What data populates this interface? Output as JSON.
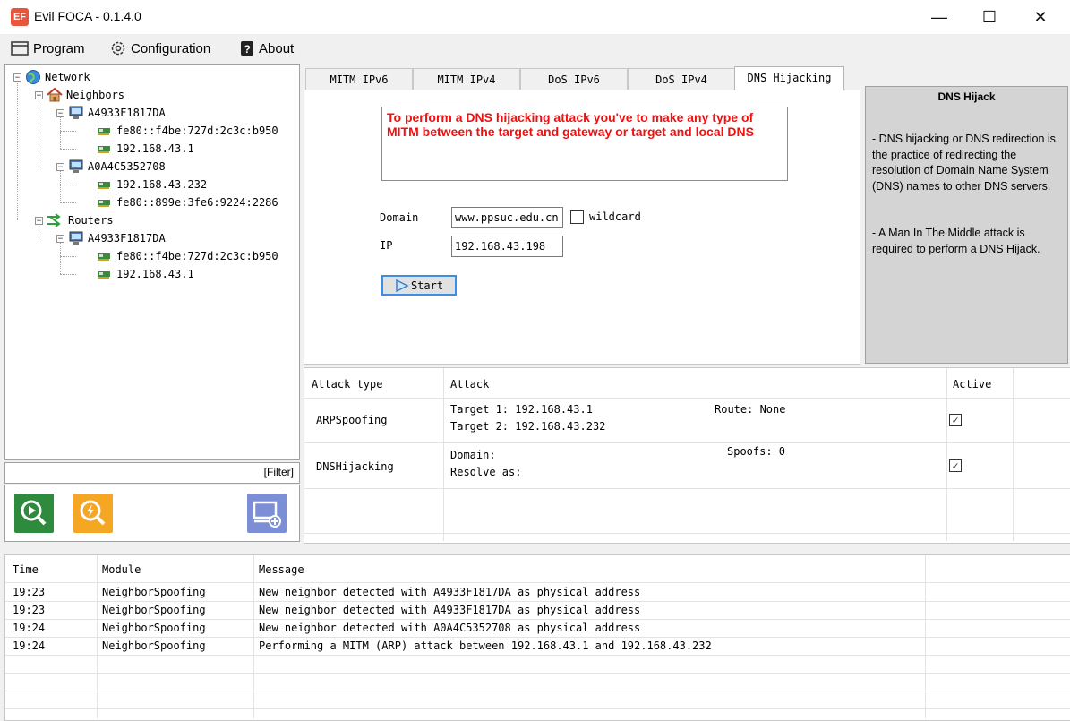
{
  "window": {
    "title": "Evil FOCA - 0.1.4.0",
    "icon_text": "EF",
    "minimize": "—",
    "maximize": "☐",
    "close": "✕"
  },
  "menu": {
    "items": [
      {
        "label": "Program",
        "icon": "window-icon"
      },
      {
        "label": "Configuration",
        "icon": "gear-icon"
      },
      {
        "label": "About",
        "icon": "help-icon"
      }
    ]
  },
  "tree": {
    "root": "Network",
    "neighbors": {
      "label": "Neighbors",
      "hosts": [
        {
          "name": "A4933F1817DA",
          "addresses": [
            "fe80::f4be:727d:2c3c:b950",
            "192.168.43.1"
          ]
        },
        {
          "name": "A0A4C5352708",
          "addresses": [
            "192.168.43.232",
            "fe80::899e:3fe6:9224:2286"
          ]
        }
      ]
    },
    "routers": {
      "label": "Routers",
      "hosts": [
        {
          "name": "A4933F1817DA",
          "addresses": [
            "fe80::f4be:727d:2c3c:b950",
            "192.168.43.1"
          ]
        }
      ]
    },
    "filter_label": "[Filter]"
  },
  "tabs": [
    {
      "label": "MITM IPv6",
      "active": false
    },
    {
      "label": "MITM IPv4",
      "active": false
    },
    {
      "label": "DoS IPv6",
      "active": false
    },
    {
      "label": "DoS IPv4",
      "active": false
    },
    {
      "label": "DNS Hijacking",
      "active": true
    }
  ],
  "dns_form": {
    "warning": "To perform a DNS hijacking attack you've to make any type of MITM between the target and gateway or target and local DNS",
    "domain_label": "Domain",
    "domain_value": "www.ppsuc.edu.cn",
    "wildcard_label": "wildcard",
    "wildcard_checked": false,
    "ip_label": "IP",
    "ip_value": "192.168.43.198",
    "start_label": "Start"
  },
  "help": {
    "title": "DNS Hijack",
    "paragraph1": "- DNS hijacking or DNS redirection is the practice of redirecting the resolution of Domain Name System (DNS) names to other DNS servers.",
    "paragraph2": "- A Man In The Middle attack is required to perform a DNS Hijack."
  },
  "attacks": {
    "headers": {
      "type": "Attack type",
      "attack": "Attack",
      "active": "Active"
    },
    "rows": [
      {
        "type": "ARPSpoofing",
        "line1": "Target 1: 192.168.43.1",
        "line2": "Target 2: 192.168.43.232",
        "extra": "Route: None",
        "active": true
      },
      {
        "type": "DNSHijacking",
        "line1": "Domain:",
        "line2": "Resolve as:",
        "extra": "Spoofs: 0",
        "active": true
      }
    ]
  },
  "log": {
    "headers": {
      "time": "Time",
      "module": "Module",
      "message": "Message"
    },
    "rows": [
      {
        "time": "19:23",
        "module": "NeighborSpoofing",
        "message": "New neighbor detected with A4933F1817DA as physical address"
      },
      {
        "time": "19:23",
        "module": "NeighborSpoofing",
        "message": "New neighbor detected with A4933F1817DA as physical address"
      },
      {
        "time": "19:24",
        "module": "NeighborSpoofing",
        "message": "New neighbor detected with A0A4C5352708 as physical address"
      },
      {
        "time": "19:24",
        "module": "NeighborSpoofing",
        "message": "Performing a MITM (ARP) attack between 192.168.43.1 and 192.168.43.232"
      }
    ]
  },
  "colors": {
    "warning_text": "#f01010",
    "scan_button": "#2e8b3e",
    "attack_button": "#f5a623",
    "add_button": "#7c8fd6",
    "start_border": "#3d8ee0"
  }
}
